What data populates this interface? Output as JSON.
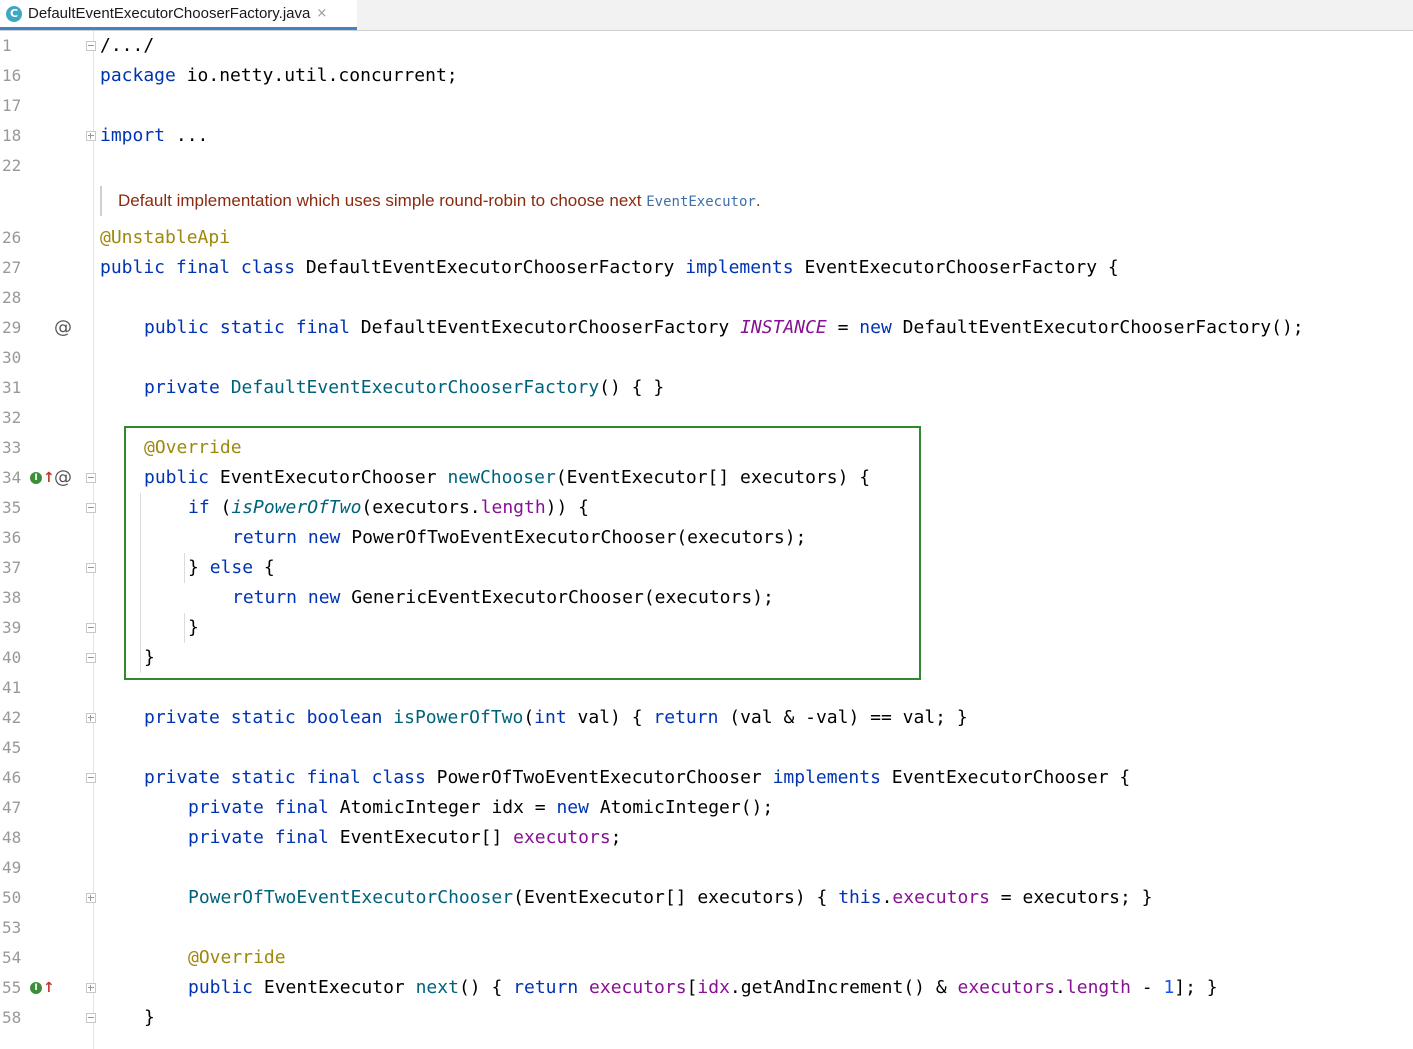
{
  "tab": {
    "icon": "C",
    "title": "DefaultEventExecutorChooserFactory.java",
    "close": "×"
  },
  "doc_comment": {
    "text": "Default implementation which uses simple round-robin to choose next ",
    "link": "EventExecutor",
    "tail": "."
  },
  "lines": [
    {
      "n": "1",
      "t": "/.../"
    },
    {
      "n": "16",
      "t": "package io.netty.util.concurrent;"
    },
    {
      "n": "17",
      "t": ""
    },
    {
      "n": "18",
      "t": "import ..."
    },
    {
      "n": "22",
      "t": ""
    },
    {
      "n": "26",
      "t": "@UnstableApi"
    },
    {
      "n": "27",
      "t": "public final class DefaultEventExecutorChooserFactory implements EventExecutorChooserFactory {"
    },
    {
      "n": "28",
      "t": ""
    },
    {
      "n": "29",
      "t": "public static final DefaultEventExecutorChooserFactory INSTANCE = new DefaultEventExecutorChooserFactory();"
    },
    {
      "n": "30",
      "t": ""
    },
    {
      "n": "31",
      "t": "private DefaultEventExecutorChooserFactory() { }"
    },
    {
      "n": "32",
      "t": ""
    },
    {
      "n": "33",
      "t": "@Override"
    },
    {
      "n": "34",
      "t": "public EventExecutorChooser newChooser(EventExecutor[] executors) {"
    },
    {
      "n": "35",
      "t": "if (isPowerOfTwo(executors.length)) {"
    },
    {
      "n": "36",
      "t": "return new PowerOfTwoEventExecutorChooser(executors);"
    },
    {
      "n": "37",
      "t": "} else {"
    },
    {
      "n": "38",
      "t": "return new GenericEventExecutorChooser(executors);"
    },
    {
      "n": "39",
      "t": "}"
    },
    {
      "n": "40",
      "t": "}"
    },
    {
      "n": "41",
      "t": ""
    },
    {
      "n": "42",
      "t": "private static boolean isPowerOfTwo(int val) { return (val & -val) == val; }"
    },
    {
      "n": "45",
      "t": ""
    },
    {
      "n": "46",
      "t": "private static final class PowerOfTwoEventExecutorChooser implements EventExecutorChooser {"
    },
    {
      "n": "47",
      "t": "private final AtomicInteger idx = new AtomicInteger();"
    },
    {
      "n": "48",
      "t": "private final EventExecutor[] executors;"
    },
    {
      "n": "49",
      "t": ""
    },
    {
      "n": "50",
      "t": "PowerOfTwoEventExecutorChooser(EventExecutor[] executors) { this.executors = executors; }"
    },
    {
      "n": "53",
      "t": ""
    },
    {
      "n": "54",
      "t": "@Override"
    },
    {
      "n": "55",
      "t": "public EventExecutor next() { return executors[idx.getAndIncrement() & executors.length - 1]; }"
    },
    {
      "n": "58",
      "t": "}"
    }
  ],
  "gutter_marks": {
    "at": "@",
    "implements": "I",
    "arrow": "↑"
  }
}
